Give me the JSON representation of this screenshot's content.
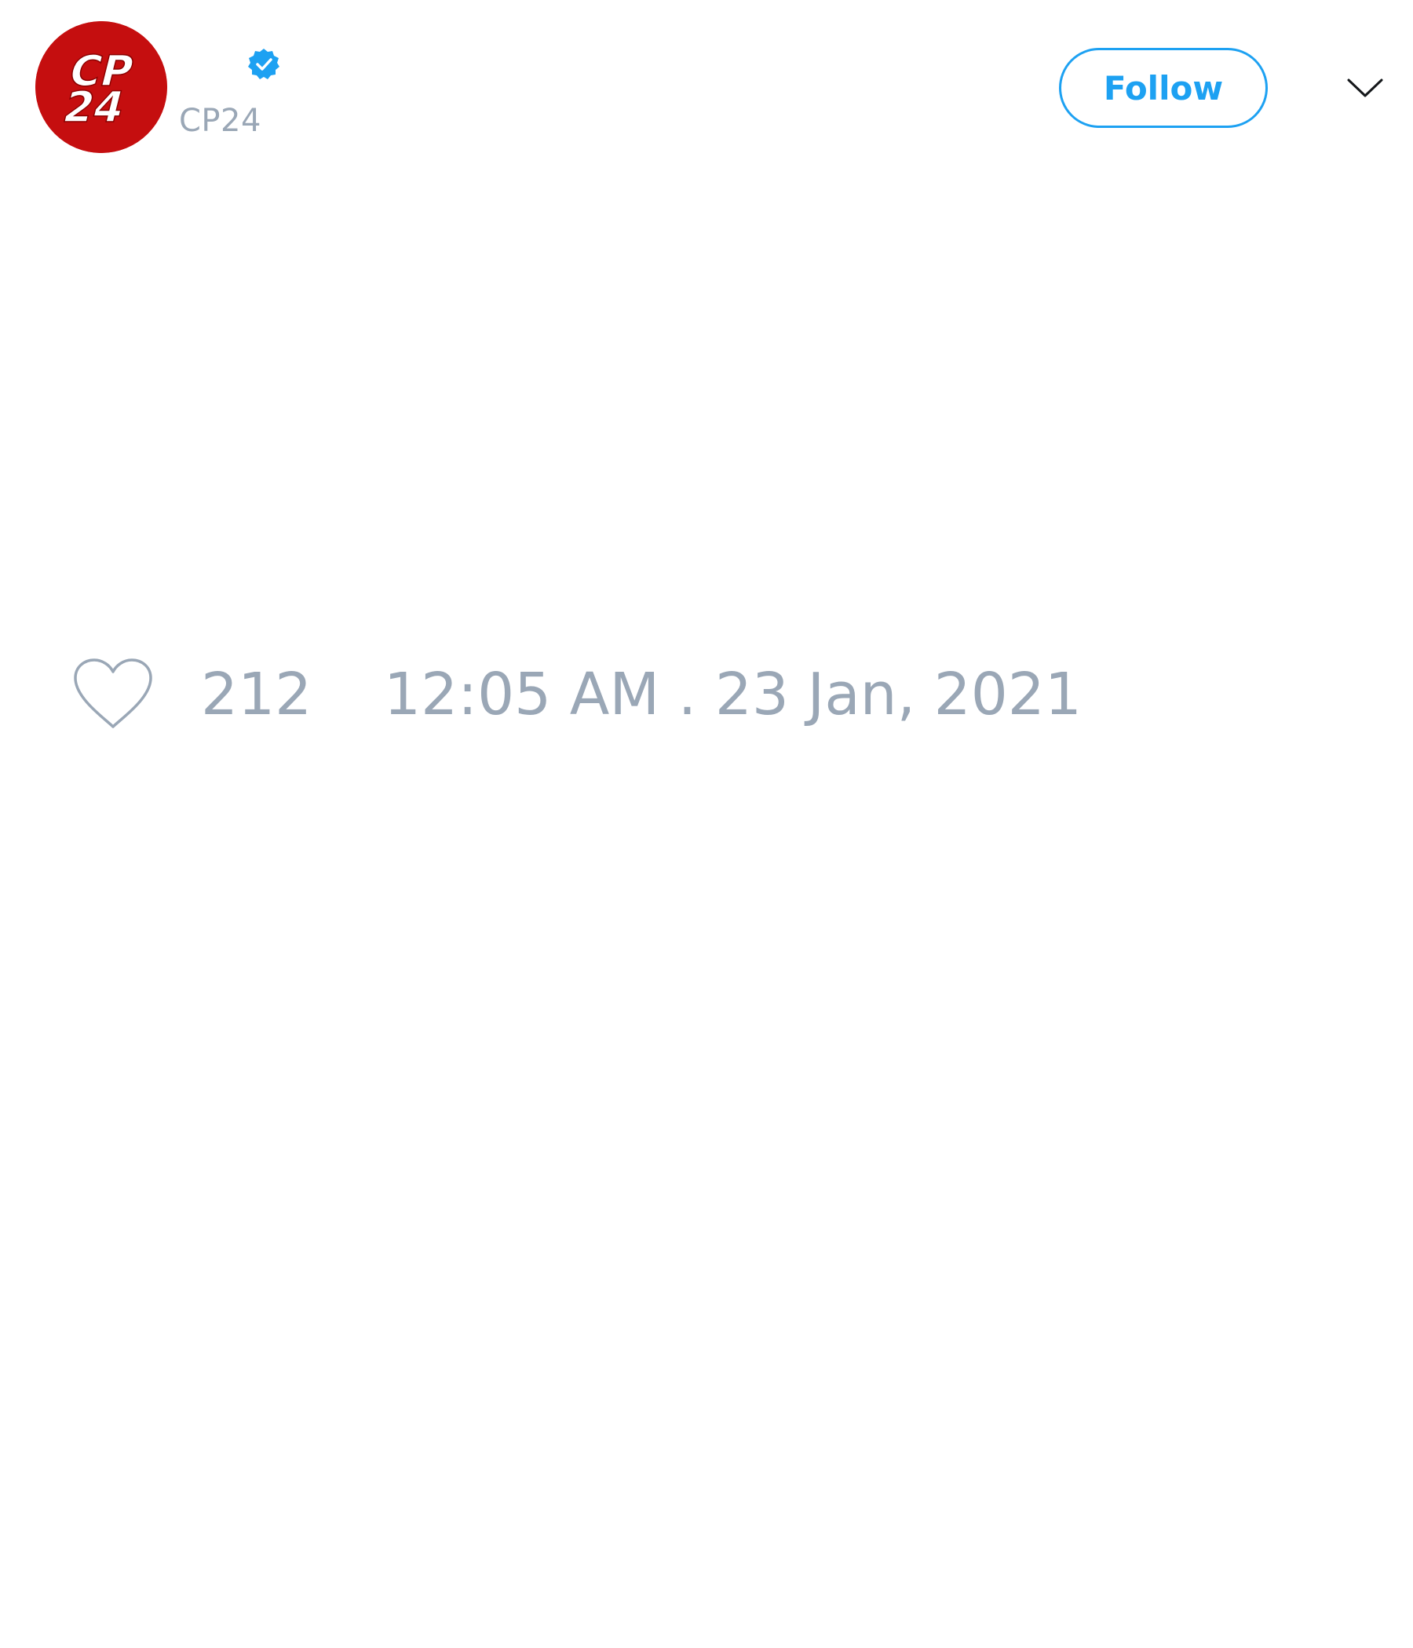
{
  "account": {
    "handle": "CP24",
    "avatar_logo_text_top": "CP",
    "avatar_logo_text_bottom": "24",
    "verified": true
  },
  "header": {
    "follow_label": "Follow",
    "menu_icon": "chevron-down-icon"
  },
  "footer": {
    "like_icon": "heart-icon",
    "like_count": "212",
    "timestamp": "12:05 AM . 23 Jan, 2021"
  },
  "colors": {
    "brand_red": "#c50e0f",
    "twitter_blue": "#1da1f2",
    "muted_gray": "#9aa7b6"
  }
}
